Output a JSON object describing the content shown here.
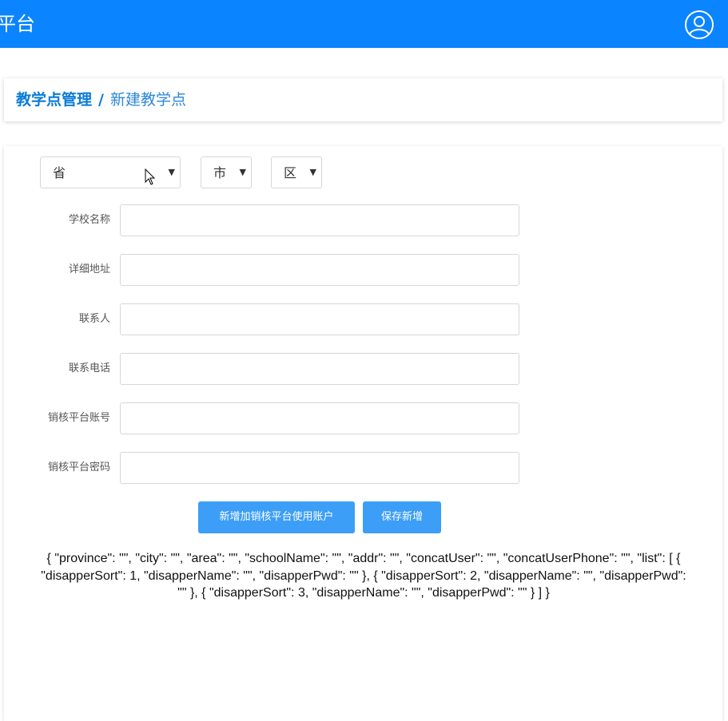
{
  "header": {
    "title": "平台",
    "accent_color": "#0a84ff"
  },
  "breadcrumb": {
    "root": "教学点管理",
    "separator": "/",
    "current": "新建教学点"
  },
  "region_selects": {
    "province": "省",
    "city": "市",
    "area": "区"
  },
  "form": {
    "fields": [
      {
        "label": "学校名称",
        "value": ""
      },
      {
        "label": "详细地址",
        "value": ""
      },
      {
        "label": "联系人",
        "value": ""
      },
      {
        "label": "联系电话",
        "value": ""
      },
      {
        "label": "销核平台账号",
        "value": ""
      },
      {
        "label": "销核平台密码",
        "value": ""
      }
    ],
    "add_account_button": "新增加销核平台使用账户",
    "save_button": "保存新增"
  },
  "debug_json": "{ \"province\": \"\", \"city\": \"\", \"area\": \"\", \"schoolName\": \"\", \"addr\": \"\", \"concatUser\": \"\", \"concatUserPhone\": \"\", \"list\": [ { \"disapperSort\": 1, \"disapperName\": \"\", \"disapperPwd\": \"\" }, { \"disapperSort\": 2, \"disapperName\": \"\", \"disapperPwd\": \"\" }, { \"disapperSort\": 3, \"disapperName\": \"\", \"disapperPwd\": \"\" } ] }"
}
